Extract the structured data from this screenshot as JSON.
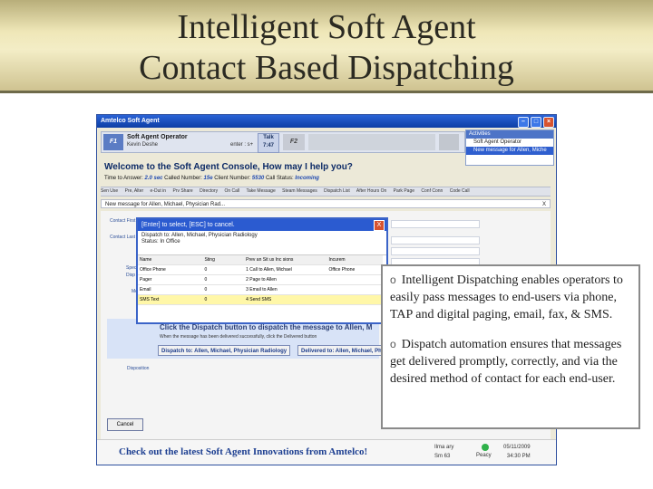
{
  "slide": {
    "title_line1": "Intelligent Soft Agent",
    "title_line2": "Contact Based Dispatching"
  },
  "app": {
    "window_title": "Amtelco Soft Agent",
    "operator": {
      "f1_label": "F1",
      "name": "Soft Agent Operator",
      "sub": "Kevin Deshe",
      "enter_hint": "enter : s+",
      "talk_label": "Talk",
      "talk_time": "7:47",
      "f2_label": "F2"
    },
    "activities": {
      "header": "Activities",
      "items": [
        "Soft Agent Operator",
        "New message for Allen, Miche"
      ]
    },
    "welcome": "Welcome to the Soft Agent Console, How may I help you?",
    "time_row": {
      "time_to_answer_label": "Time to Answer:",
      "time_to_answer": "2.0 sec",
      "called_number_label": "Called Number:",
      "called_number": "15e",
      "client_number_label": "Client Number:",
      "client_number": "5530",
      "call_status_label": "Call Status:",
      "call_status": "Incoming"
    },
    "toolbar_items": [
      "Sen Use",
      "Pre, Alter",
      "e-Dut in",
      "Prv Share",
      "Directory",
      "On Call",
      "Take Message",
      "Steam Messages",
      "Dispatch List",
      "After Hours On",
      "Park Page",
      "Conf Conn",
      "Code Call"
    ],
    "tab_label": "New message for Allen, Michael, Physician Rad...",
    "tab_close": "X",
    "form_labels": {
      "contact_first": "Contact First",
      "contact_last": "Contact Last",
      "spec": "Spec",
      "disp": "Disp",
      "me": "Me",
      "disposition": "Disposition"
    },
    "dialog": {
      "title": "[Enter] to select, [ESC] to cancel.",
      "message_lines": [
        "Dispatch to: Allen, Michael, Physician Radiology",
        "Status: In Office"
      ],
      "close": "X",
      "columns": [
        "Name",
        "Sting",
        "Prev an Sit us Inc sions",
        "Incurem"
      ],
      "rows": [
        {
          "name": "Office Phone",
          "sting": "0",
          "prev": "1 Call to Allen, Michael",
          "inc": "Office Phone"
        },
        {
          "name": "Pager",
          "sting": "0",
          "prev": "2 Page to Allen",
          "inc": ""
        },
        {
          "name": "Email",
          "sting": "0",
          "prev": "3 Email to Allen",
          "inc": ""
        },
        {
          "name": "SMS Text",
          "sting": "0",
          "prev": "4 Send SMS",
          "inc": ""
        }
      ]
    },
    "dispatch": {
      "message": "Click the Dispatch button to dispatch the message to Allen, M",
      "note": "When the message has been delivered successfully, click the Delivered button",
      "dispatch_button": "Dispatch to: Allen, Michael, Physician Radiology",
      "delivered_button": "Delivered to: Allen, Michael, Ph"
    },
    "cancel_label": "Cancel",
    "footer": {
      "text": "Check out the latest Soft Agent Innovations from Amtelco!",
      "status_line1": "Ilma ary",
      "status_line2": "Sm 63",
      "status_line3": "Peacy",
      "date": "05/11/2009",
      "time": "34:30 PM"
    }
  },
  "callout": {
    "bullet": "o",
    "point1": "Intelligent Dispatching enables operators to easily pass messages to end-users via phone, TAP and digital paging, email, fax, & SMS.",
    "point2": "Dispatch automation ensures that messages get delivered promptly, correctly, and via the desired method of contact for each end-user."
  }
}
